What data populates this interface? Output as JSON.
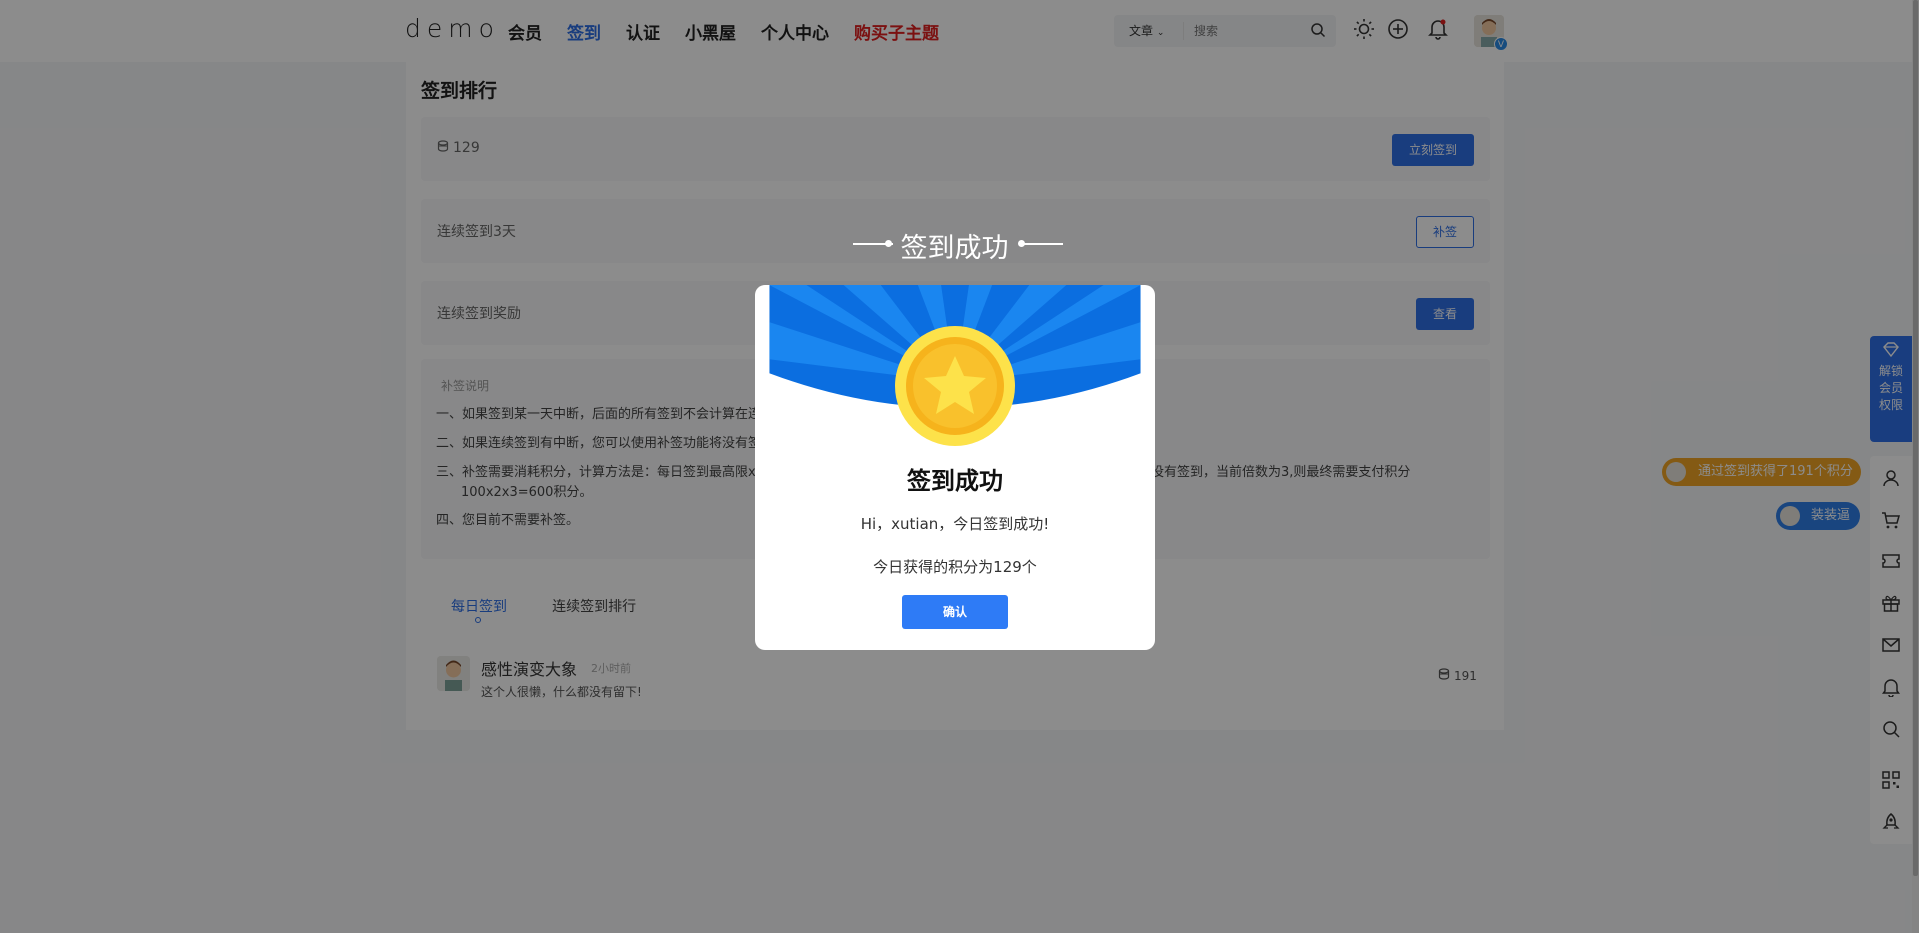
{
  "header": {
    "logo": "demo",
    "nav": [
      "会员",
      "签到",
      "认证",
      "小黑屋",
      "个人中心",
      "购买子主题"
    ],
    "search_select": "文章",
    "search_placeholder": "搜索",
    "verified_badge": "V"
  },
  "page": {
    "title": "签到排行",
    "points": "129",
    "checkin_button": "立刻签到",
    "streak_text": "连续签到3天",
    "makeup_button": "补签",
    "reward_text": "连续签到奖励",
    "view_button": "查看",
    "desc_heading": "补签说明",
    "desc_items": [
      "一、如果签到某一天中断，后面的所有签到不会计算在连",
      "二、如果连续签到有中断，您可以使用补签功能将没有签",
      "三、补签需要消耗积分，计算方法是：每日签到最高限x",
      "100x2x3=600积分。",
      "四、您目前不需要补签。"
    ],
    "desc_item3_tail": "没有签到，当前倍数为3,则最终需要支付积分",
    "tabs": [
      "每日签到",
      "连续签到排行"
    ],
    "user": {
      "name": "感性演变大象",
      "time": "2小时前",
      "signature": "这个人很懒，什么都没有留下!",
      "points": "191"
    }
  },
  "floating": {
    "vip_unlock": [
      "解锁",
      "会员",
      "权限"
    ],
    "notice_orange": "通过签到获得了191个积分",
    "notice_blue": "装装逼"
  },
  "modal": {
    "banner_title": "签到成功",
    "title": "签到成功",
    "line1": "Hi，xutian，今日签到成功!",
    "line2": "今日获得的积分为129个",
    "confirm": "确认"
  },
  "colors": {
    "accent": "#2e6fe6",
    "red_nav": "#e02020",
    "orange": "#f0a526",
    "modal_blue": "#0a6fe0"
  }
}
